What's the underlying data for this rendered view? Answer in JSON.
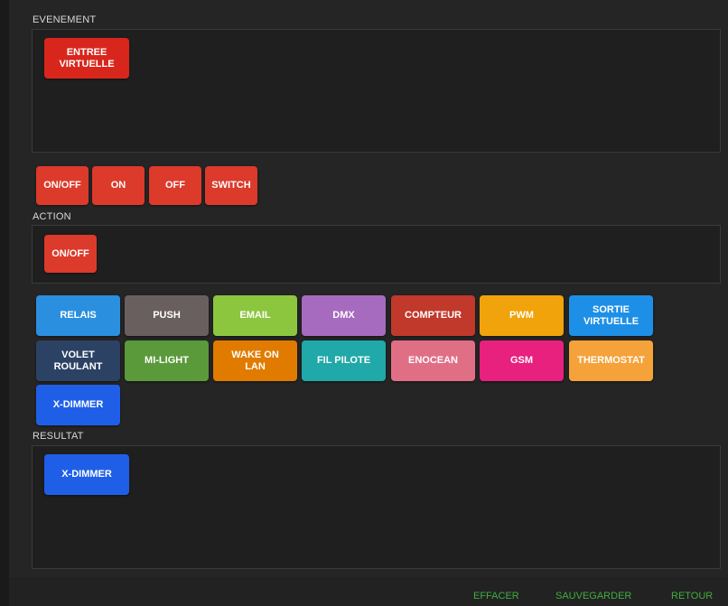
{
  "sections": {
    "evenement": "EVENEMENT",
    "action": "ACTION",
    "resultat": "RESULTAT"
  },
  "evenement_selected": {
    "label": "ENTREE VIRTUELLE",
    "color": "#d9261c"
  },
  "event_buttons": [
    {
      "label": "ON/OFF",
      "color": "#dc3a2b"
    },
    {
      "label": "ON",
      "color": "#dc3a2b"
    },
    {
      "label": "OFF",
      "color": "#dc3a2b"
    },
    {
      "label": "SWITCH",
      "color": "#dc3a2b"
    }
  ],
  "action_selected": {
    "label": "ON/OFF",
    "color": "#dc3a2b"
  },
  "result_types": [
    {
      "label": "RELAIS",
      "color": "#2b8fe0"
    },
    {
      "label": "PUSH",
      "color": "#6a5f5f"
    },
    {
      "label": "EMAIL",
      "color": "#8cc63f"
    },
    {
      "label": "DMX",
      "color": "#a66bbe"
    },
    {
      "label": "COMPTEUR",
      "color": "#c0392b"
    },
    {
      "label": "PWM",
      "color": "#f0a30a"
    },
    {
      "label": "SORTIE VIRTUELLE",
      "color": "#1e8fe6"
    },
    {
      "label": "VOLET ROULANT",
      "color": "#2c4264"
    },
    {
      "label": "MI-LIGHT",
      "color": "#5b9a3b"
    },
    {
      "label": "WAKE ON LAN",
      "color": "#e07b00"
    },
    {
      "label": "FIL PILOTE",
      "color": "#21a8a8"
    },
    {
      "label": "ENOCEAN",
      "color": "#e06f86"
    },
    {
      "label": "GSM",
      "color": "#e8207e"
    },
    {
      "label": "THERMOSTAT",
      "color": "#f5a23a"
    },
    {
      "label": "X-DIMMER",
      "color": "#1f5fe8"
    }
  ],
  "resultat_selected": {
    "label": "X-DIMMER",
    "color": "#1f5fe8"
  },
  "footer": {
    "effacer": "EFFACER",
    "sauvegarder": "SAUVEGARDER",
    "retour": "RETOUR"
  }
}
